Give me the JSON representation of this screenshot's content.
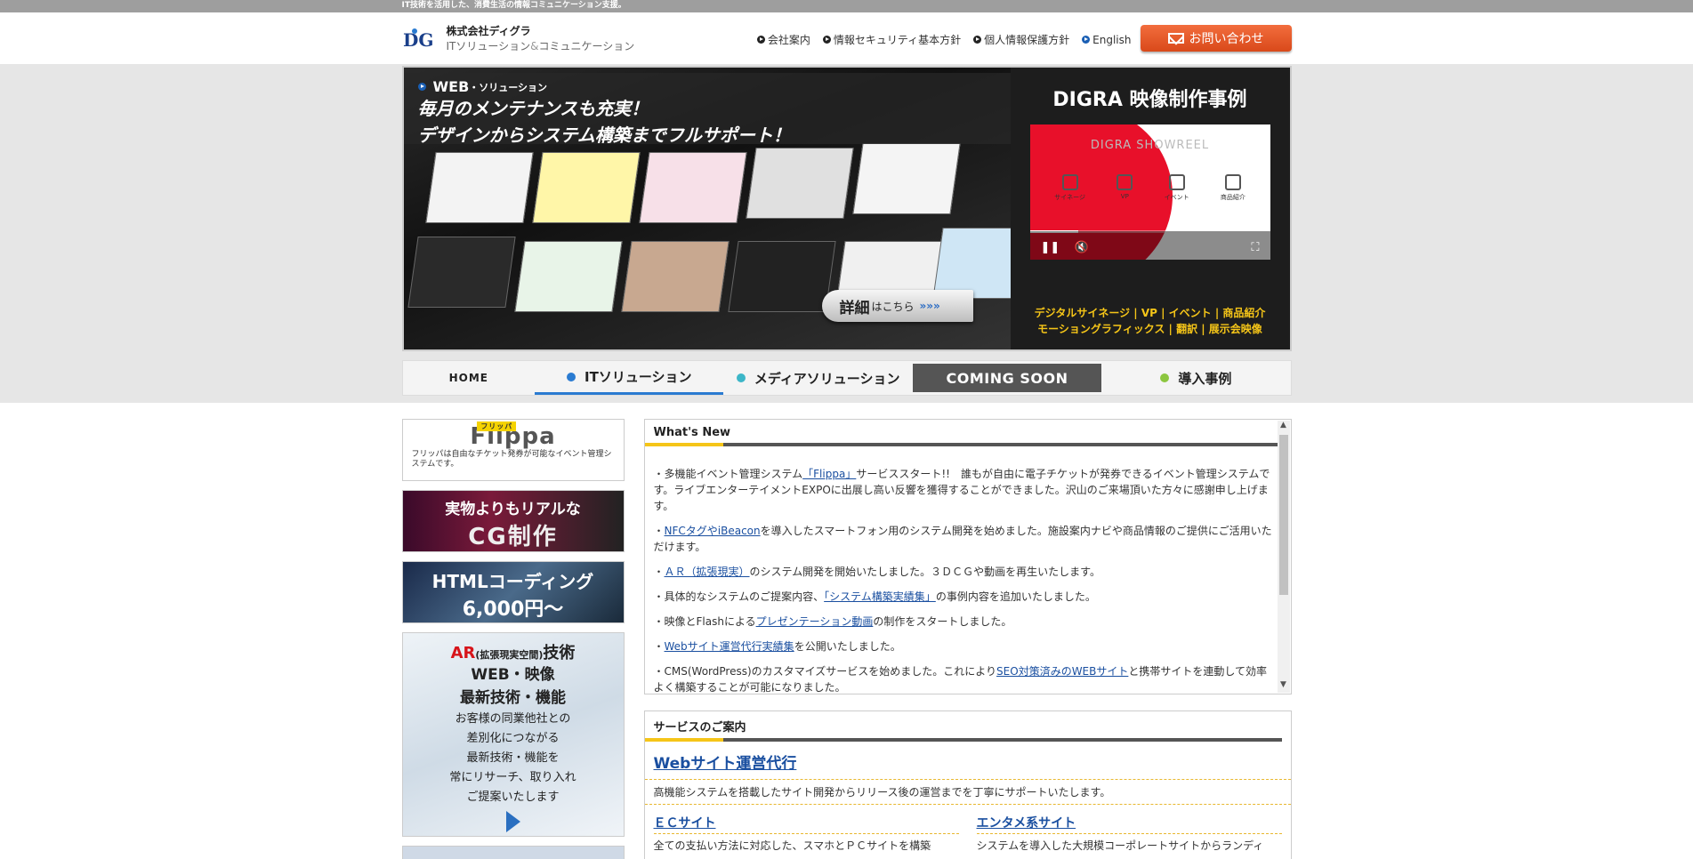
{
  "topbar": {
    "text": "IT技術を活用した、消費生活の情報コミュニケーション支援。"
  },
  "header": {
    "logo_mark": "DG",
    "company": "株式会社ディグラ",
    "tagline_a": "ITソリューション",
    "tagline_amp": "&",
    "tagline_b": "コミュニケーション",
    "nav": [
      {
        "label": "会社案内"
      },
      {
        "label": "情報セキュリティ基本方針"
      },
      {
        "label": "個人情報保護方針"
      },
      {
        "label": "English"
      }
    ],
    "contact_label": "お問い合わせ"
  },
  "hero": {
    "category": "WEB",
    "category_sub": "・ソリューション",
    "line1": "毎月のメンテナンスも充実！",
    "line2": "デザインからシステム構築までフルサポート！",
    "detail_main": "詳細",
    "detail_sub": "はこちら",
    "detail_arrows": "»»»",
    "video_title": "DIGRA 映像制作事例",
    "video_inner_title": "DIGRA SHOWREEL",
    "video_icons": [
      "サイネージ",
      "VP",
      "イベント",
      "商品紹介"
    ],
    "video_progress": 0.2,
    "tags_line1": "デジタルサイネージ | VP | イベント | 商品紹介",
    "tags_line2": "モーショングラフィックス | 翻訳 | 展示会映像"
  },
  "gnav": {
    "home": "HOME",
    "it": "ITソリューション",
    "media": "メディアソリューション",
    "soon": "COMING SOON",
    "cases": "導入事例",
    "colors": {
      "it": "#2a7bd1",
      "media": "#3cb6c8",
      "cases": "#8cc63f"
    }
  },
  "side": {
    "flippa_label": "フリッパ",
    "flippa_logo": "Flippa",
    "flippa_desc": "フリッパは自由なチケット発券が可能なイベント管理システムです。",
    "cg_1": "実物よりもリアルな",
    "cg_2": "CG制作",
    "html_1": "HTMLコーディング",
    "html_2": "6,000円～",
    "ar_head": "AR",
    "ar_small": "(拡張現実空間)",
    "ar_tech": "技術",
    "ar_2": "WEB・映像",
    "ar_3": "最新技術・機能",
    "ar_lines": [
      "お客様の同業他社との",
      "差別化につながる",
      "最新技術・機能を",
      "常にリサーチ、取り入れ",
      "ご提案いたします"
    ]
  },
  "news": {
    "title": "What's New",
    "items": [
      {
        "pre": "・多機能イベント管理システム",
        "link": "「Flippa」",
        "post": "サービススタート!!　誰もが自由に電子チケットが発券できるイベント管理システムです。ライブエンターテイメントEXPOに出展し高い反響を獲得することができました。沢山のご来場頂いた方々に感謝申し上げます。"
      },
      {
        "pre": "・",
        "link": "NFCタグやiBeacon",
        "post": "を導入したスマートフォン用のシステム開発を始めました。施設案内ナビや商品情報のご提供にご活用いただけます。"
      },
      {
        "pre": "・",
        "link": "ＡＲ（拡張現実）",
        "post": "のシステム開発を開始いたしました。３ＤＣＧや動画を再生いたします。"
      },
      {
        "pre": "・具体的なシステムのご提案内容、",
        "link": "「システム構築実績集」",
        "post": "の事例内容を追加いたしました。"
      },
      {
        "pre": "・映像とFlashによる",
        "link": "プレゼンテーション動画",
        "post": "の制作をスタートしました。"
      },
      {
        "pre": "・",
        "link": "Webサイト運営代行実績集",
        "post": "を公開いたしました。"
      },
      {
        "pre": "・CMS(WordPress)のカスタマイズサービスを始めました。これにより",
        "link": "SEO対策済みのWEBサイト",
        "post": "と携帯サイトを連動して効率よく構築することが可能になりました。"
      }
    ]
  },
  "services": {
    "title": "サービスのご案内",
    "main_link": "Webサイト運営代行",
    "main_desc": "高機能システムを搭載したサイト開発からリリース後の運営までを丁寧にサポートいたします。",
    "col1_link": "ＥＣサイト",
    "col1_desc": "全ての支払い方法に対応した、スマホとＰＣサイトを構築",
    "col2_link": "エンタメ系サイト",
    "col2_desc": "システムを導入した大規模コーポレートサイトからランディ"
  }
}
